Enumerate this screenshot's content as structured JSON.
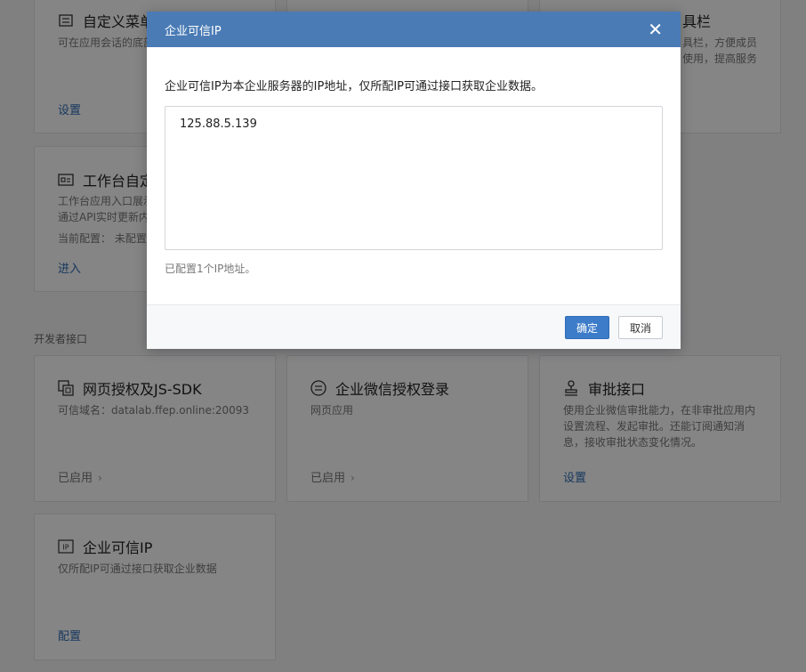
{
  "cards_top": [
    {
      "title": "自定义菜单",
      "desc": "可在应用会话的底部",
      "link": "设置"
    },
    {
      "title": "",
      "desc": "",
      "link": ""
    },
    {
      "title": "具栏",
      "desc": "具栏，方便成员\n使用，提高服务",
      "link": ""
    }
  ],
  "workbench": {
    "title": "工作台自定",
    "desc": "工作台应用入口展示\n通过API实时更新内",
    "meta": "当前配置：  未配置",
    "link": "进入"
  },
  "section_label": "开发者接口",
  "dev_cards": [
    {
      "title": "网页授权及JS-SDK",
      "desc": "可信域名：datalab.ffep.online:20093",
      "link": "已启用"
    },
    {
      "title": "企业微信授权登录",
      "desc": "网页应用",
      "link": "已启用"
    },
    {
      "title": "审批接口",
      "desc": "使用企业微信审批能力，在非审批应用内设置流程、发起审批。还能订阅通知消息，接收审批状态变化情况。",
      "link": "设置"
    },
    {
      "title": "企业可信IP",
      "desc": "仅所配IP可通过接口获取企业数据",
      "link": "配置"
    }
  ],
  "modal": {
    "title": "企业可信IP",
    "close": "✕",
    "description": "企业可信IP为本企业服务器的IP地址，仅所配IP可通过接口获取企业数据。",
    "ip_value": "125.88.5.139",
    "count_text": "已配置1个IP地址。",
    "confirm_label": "确定",
    "cancel_label": "取消"
  },
  "colors": {
    "accent": "#4a7bb5",
    "link": "#2f6cb5",
    "primary_button": "#3d7cc9"
  }
}
